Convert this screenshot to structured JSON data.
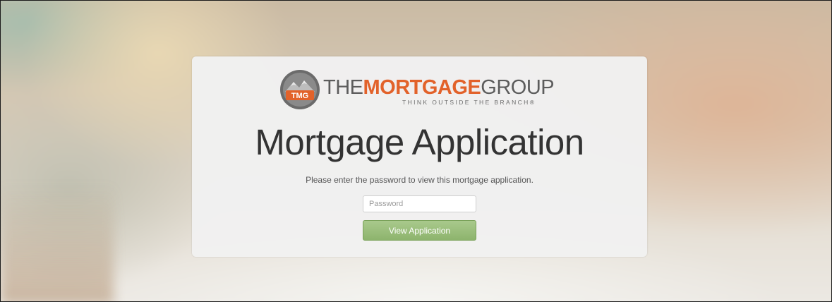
{
  "logo": {
    "mark_text": "TMG",
    "word_the": "THE",
    "word_mortgage": "MORTGAGE",
    "word_group": "GROUP",
    "tagline": "THINK OUTSIDE THE BRANCH®",
    "brand_color": "#e2622a",
    "text_color": "#5c5c5c"
  },
  "main": {
    "title": "Mortgage Application",
    "instructions": "Please enter the password to view this mortgage application."
  },
  "form": {
    "password_value": "",
    "password_placeholder": "Password",
    "submit_label": "View Application",
    "submit_color": "#8db46d"
  }
}
